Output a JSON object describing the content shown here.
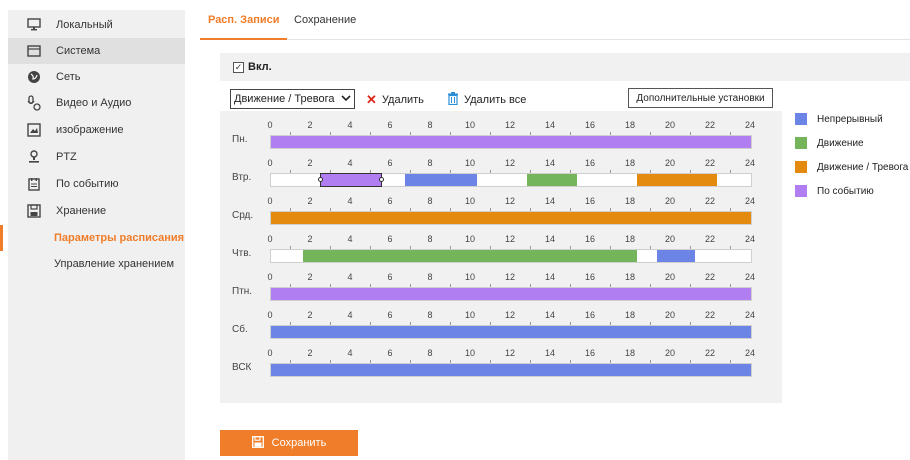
{
  "sidebar": {
    "items": [
      {
        "label": "Локальный",
        "icon": "monitor-icon"
      },
      {
        "label": "Система",
        "icon": "window-icon"
      },
      {
        "label": "Сеть",
        "icon": "globe-icon"
      },
      {
        "label": "Видео и Аудио",
        "icon": "video-audio-icon"
      },
      {
        "label": "изображение",
        "icon": "image-icon"
      },
      {
        "label": "PTZ",
        "icon": "ptz-icon"
      },
      {
        "label": "По событию",
        "icon": "event-icon"
      },
      {
        "label": "Хранение",
        "icon": "storage-icon"
      }
    ],
    "subitems": [
      {
        "label": "Параметры расписания",
        "active": true
      },
      {
        "label": "Управление хранением",
        "active": false
      }
    ]
  },
  "tabs": [
    {
      "label": "Расп. Записи",
      "active": true
    },
    {
      "label": "Сохранение",
      "active": false
    }
  ],
  "enable": {
    "label": "Вкл.",
    "checked": true
  },
  "toolbar": {
    "select_value": "Движение / Тревога",
    "delete_label": "Удалить",
    "delete_all_label": "Удалить все",
    "advanced_label": "Дополнительные установки"
  },
  "hours": [
    "0",
    "2",
    "4",
    "6",
    "8",
    "10",
    "12",
    "14",
    "16",
    "18",
    "20",
    "22",
    "24"
  ],
  "days": [
    {
      "label": "Пн.",
      "segments": [
        {
          "start": 0,
          "end": 24,
          "type": "event"
        }
      ]
    },
    {
      "label": "Втр.",
      "segments": [
        {
          "start": 2.5,
          "end": 5.5,
          "type": "event",
          "selected": true
        },
        {
          "start": 6.7,
          "end": 10.3,
          "type": "continuous"
        },
        {
          "start": 12.8,
          "end": 15.3,
          "type": "motion"
        },
        {
          "start": 18.3,
          "end": 22.3,
          "type": "motion_alarm"
        }
      ]
    },
    {
      "label": "Срд.",
      "segments": [
        {
          "start": 0,
          "end": 24,
          "type": "motion_alarm"
        }
      ]
    },
    {
      "label": "Чтв.",
      "segments": [
        {
          "start": 1.6,
          "end": 18.3,
          "type": "motion"
        },
        {
          "start": 19.3,
          "end": 21.2,
          "type": "continuous"
        }
      ]
    },
    {
      "label": "Птн.",
      "segments": [
        {
          "start": 0,
          "end": 24,
          "type": "event"
        }
      ]
    },
    {
      "label": "Сб.",
      "segments": [
        {
          "start": 0,
          "end": 24,
          "type": "continuous"
        }
      ]
    },
    {
      "label": "ВСК",
      "segments": [
        {
          "start": 0,
          "end": 24,
          "type": "continuous"
        }
      ]
    }
  ],
  "legend": [
    {
      "type": "continuous",
      "label": "Непрерывный",
      "color": "#6b84e6"
    },
    {
      "type": "motion",
      "label": "Движение",
      "color": "#74b55c"
    },
    {
      "type": "motion_alarm",
      "label": "Движение / Тревога",
      "color": "#e48a0e"
    },
    {
      "type": "event",
      "label": "По событию",
      "color": "#b07ef0"
    }
  ],
  "save_label": "Сохранить",
  "colors": {
    "accent": "#f07d2a"
  }
}
